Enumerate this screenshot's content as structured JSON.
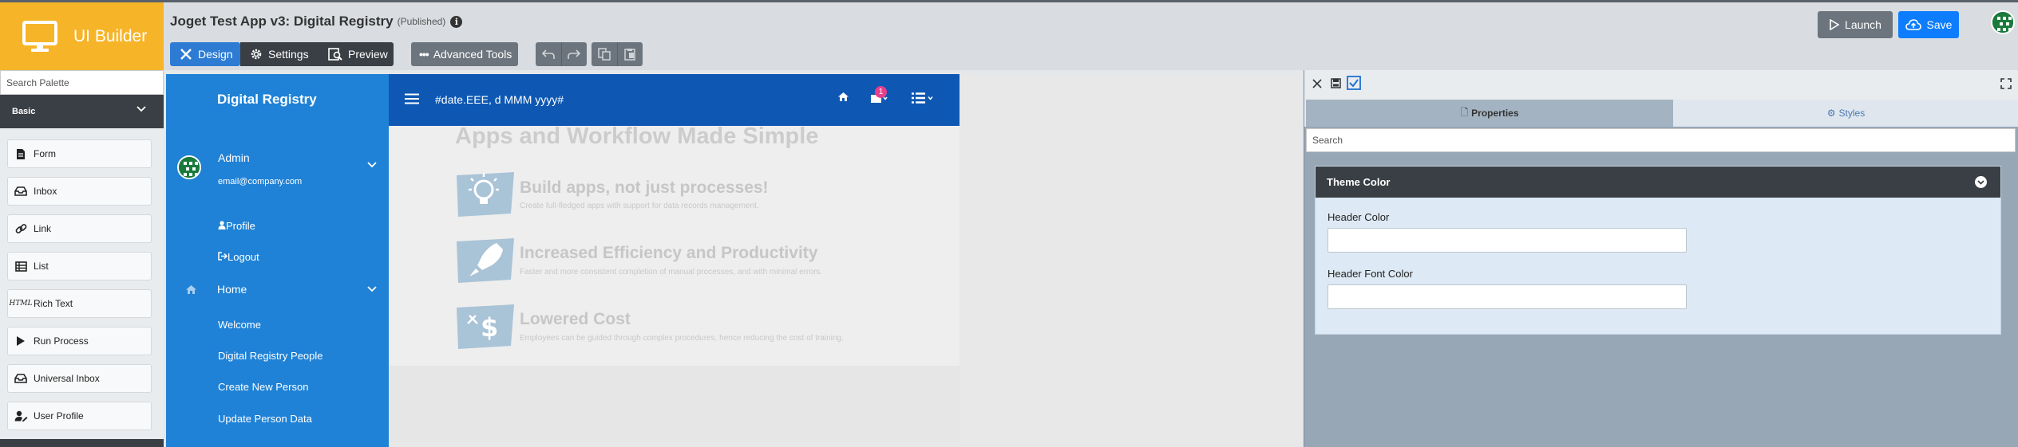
{
  "brand": {
    "title": "UI Builder"
  },
  "header": {
    "app_title": "Joget Test App v3: Digital Registry",
    "status": "(Published)",
    "info_icon": "info-icon",
    "tabs": [
      {
        "label": "Design",
        "icon": "design-tools-icon",
        "active": true
      },
      {
        "label": "Settings",
        "icon": "gear-icon",
        "active": false
      },
      {
        "label": "Preview",
        "icon": "preview-icon",
        "active": false
      }
    ],
    "advanced_tools_label": "Advanced Tools",
    "launch_label": "Launch",
    "save_label": "Save",
    "colors": {
      "design_tab": "#2e7bd4",
      "save": "#0d7dfd",
      "brand": "#f6b429"
    }
  },
  "palette": {
    "search_placeholder": "Search Palette",
    "category": "Basic",
    "items": [
      {
        "label": "Form",
        "icon": "form-icon"
      },
      {
        "label": "Inbox",
        "icon": "inbox-icon"
      },
      {
        "label": "Link",
        "icon": "link-icon"
      },
      {
        "label": "List",
        "icon": "list-table-icon"
      },
      {
        "label": "Rich Text",
        "icon": "html-icon",
        "tag": "HTML"
      },
      {
        "label": "Run Process",
        "icon": "play-icon"
      },
      {
        "label": "Universal Inbox",
        "icon": "inbox-icon"
      },
      {
        "label": "User Profile",
        "icon": "user-edit-icon"
      }
    ]
  },
  "canvas": {
    "nav_title": "Digital Registry",
    "user_name": "Admin",
    "user_email": "email@company.com",
    "profile_label": "Profile",
    "logout_label": "Logout",
    "home_label": "Home",
    "menu_items": [
      "Welcome",
      "Digital Registry People",
      "Create New Person",
      "Update Person Data"
    ],
    "date_format": "#date.EEE, d MMM yyyy#",
    "inbox_badge": "1",
    "hero_title": "Apps and Workflow Made Simple",
    "features": [
      {
        "title": "Build apps, not just processes!",
        "desc": "Create full-fledged apps with support for data records management.",
        "icon": "lightbulb-icon"
      },
      {
        "title": "Increased Efficiency and Productivity",
        "desc": "Faster and more consistent completion of manual processes, and with minimal errors.",
        "icon": "rocket-icon"
      },
      {
        "title": "Lowered Cost",
        "desc": "Employees can be guided through complex procedures, hence reducing the cost of training.",
        "icon": "money-icon"
      }
    ],
    "colors": {
      "nav_bg": "#1f82d6",
      "header_bg": "#0e58b4"
    }
  },
  "properties": {
    "tab_properties": "Properties",
    "tab_styles": "Styles",
    "search_placeholder": "Search",
    "section_title": "Theme Color",
    "fields": [
      {
        "label": "Header Color",
        "value": ""
      },
      {
        "label": "Header Font Color",
        "value": ""
      }
    ]
  }
}
